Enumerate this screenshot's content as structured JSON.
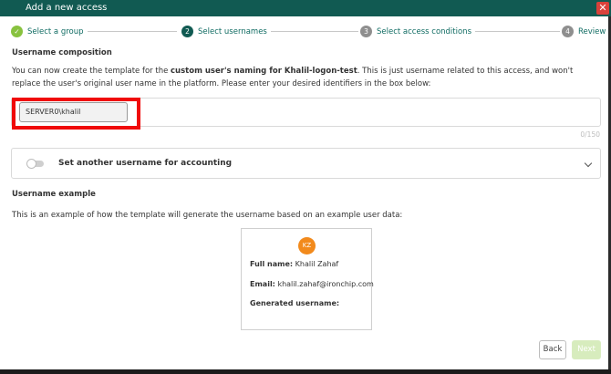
{
  "window": {
    "title": "Add a new access",
    "close_icon": "close-icon"
  },
  "stepper": {
    "steps": [
      {
        "label": "Select a group",
        "marker": "✓",
        "state": "done"
      },
      {
        "label": "Select usernames",
        "marker": "2",
        "state": "active"
      },
      {
        "label": "Select access conditions",
        "marker": "3",
        "state": "pending"
      },
      {
        "label": "Review",
        "marker": "4",
        "state": "pending"
      }
    ]
  },
  "composition": {
    "heading": "Username composition",
    "intro_1": "You can now create the template for the ",
    "intro_bold_1": "custom user's naming for Khalil-logon-test",
    "intro_2": ". This is just username related to this access, and won't replace the user's original user name in the platform. Please enter your desired identifiers in the box below:",
    "chip_value": "SERVER0\\khalil",
    "counter": "0/150"
  },
  "accounting": {
    "label": "Set another username for accounting",
    "toggle_on": false
  },
  "example": {
    "heading": "Username example",
    "description": "This is an example of how the template will generate the username based on an example user data:",
    "avatar_initials": "KZ",
    "full_name_label": "Full name:",
    "full_name_value": "Khalil Zahaf",
    "email_label": "Email:",
    "email_value": "khalil.zahaf@ironchip.com",
    "generated_label": "Generated username:",
    "generated_value": ""
  },
  "footer": {
    "back_label": "Back",
    "next_label": "Next"
  },
  "colors": {
    "header": "#115a52",
    "accent": "#88c23f",
    "highlight": "#f00a0a",
    "avatar": "#f28a1c"
  }
}
